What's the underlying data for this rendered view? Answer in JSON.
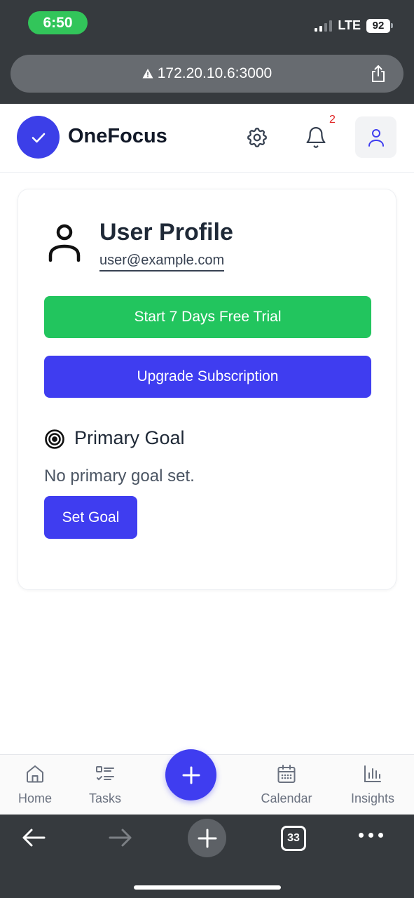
{
  "status_bar": {
    "time": "6:50",
    "network": "LTE",
    "battery": "92"
  },
  "browser": {
    "url": "172.20.10.6:3000",
    "tab_count": "33"
  },
  "header": {
    "app_name": "OneFocus",
    "notification_count": "2"
  },
  "profile": {
    "title": "User Profile",
    "email": "user@example.com",
    "trial_button": "Start 7 Days Free Trial",
    "upgrade_button": "Upgrade Subscription"
  },
  "goal": {
    "heading": "Primary Goal",
    "empty_text": "No primary goal set.",
    "set_button": "Set Goal"
  },
  "nav": {
    "home": "Home",
    "tasks": "Tasks",
    "calendar": "Calendar",
    "insights": "Insights"
  },
  "colors": {
    "primary": "#3f3df0",
    "success": "#22c55e",
    "notification": "#e02424"
  }
}
